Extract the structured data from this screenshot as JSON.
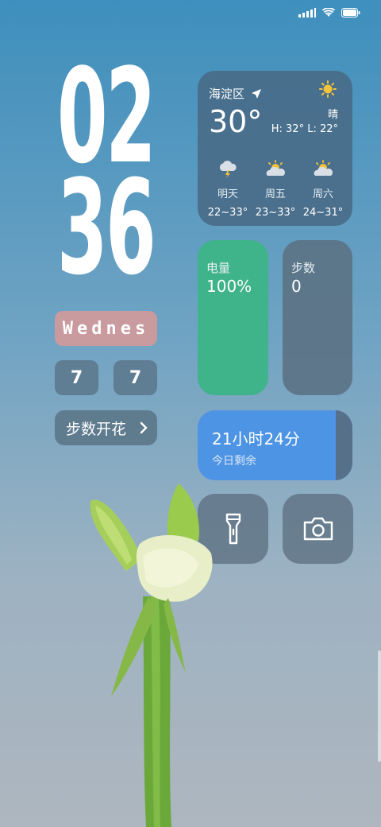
{
  "clock": {
    "hour": "02",
    "minute": "36"
  },
  "date": {
    "weekday": "Wednes",
    "month": "7",
    "day": "7"
  },
  "steps_flower": {
    "label": "步数开花"
  },
  "weather": {
    "location": "海淀区",
    "temp": "30°",
    "condition": "晴",
    "high_low": "H: 32°  L: 22°",
    "forecast": [
      {
        "day": "明天",
        "range": "22~33°",
        "icon": "thunder-cloud-icon"
      },
      {
        "day": "周五",
        "range": "23~33°",
        "icon": "partly-sunny-icon"
      },
      {
        "day": "周六",
        "range": "24~31°",
        "icon": "partly-sunny-icon"
      }
    ]
  },
  "battery": {
    "label": "电量",
    "value": "100%",
    "color": "#3fb389"
  },
  "steps": {
    "label": "步数",
    "value": "0"
  },
  "timer": {
    "time": "21小时24分",
    "label": "今日剩余",
    "fraction_elapsed": 0.89,
    "color": "#4d94e4"
  }
}
